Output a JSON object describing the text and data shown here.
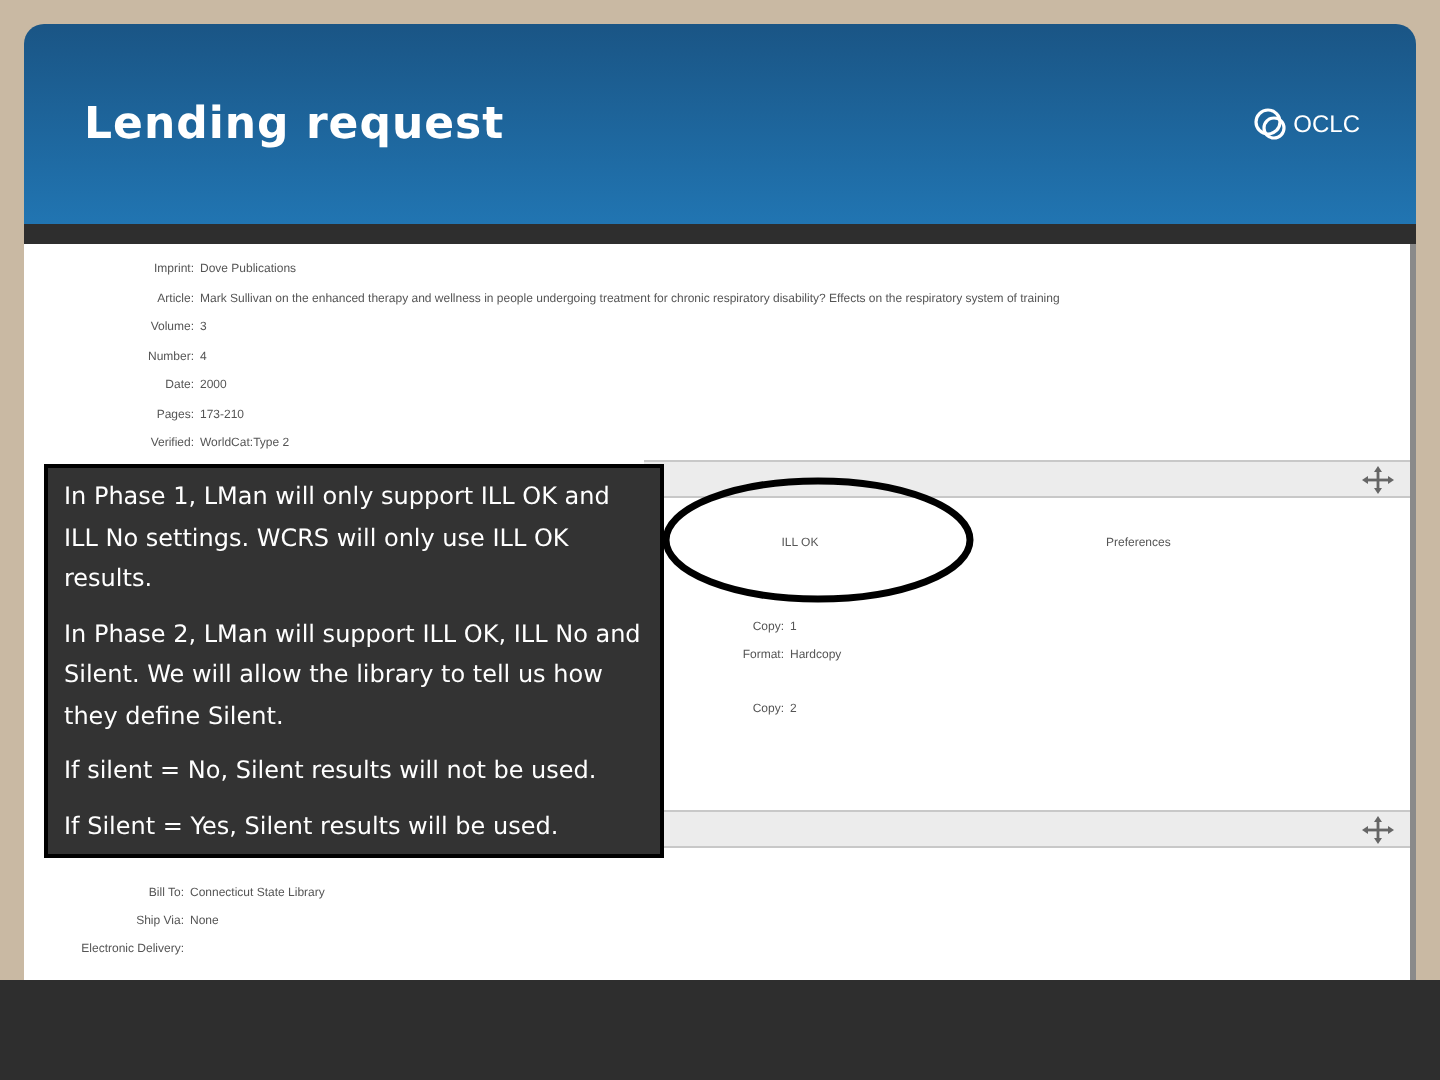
{
  "slide": {
    "title": "Lending request",
    "logo_text": "OCLC"
  },
  "screenshot": {
    "top_fields": [
      {
        "label": "Imprint:",
        "value": "Dove Publications"
      },
      {
        "label": "Article:",
        "value": "Mark Sullivan on the enhanced therapy and wellness in people undergoing treatment for chronic respiratory disability? Effects on the respiratory system of training"
      },
      {
        "label": "Volume:",
        "value": "3"
      },
      {
        "label": "Number:",
        "value": "4"
      },
      {
        "label": "Date:",
        "value": "2000"
      },
      {
        "label": "Pages:",
        "value": "173-210"
      },
      {
        "label": "Verified:",
        "value": "WorldCat:Type 2"
      }
    ],
    "middle": {
      "status": "ILL OK",
      "column_2": "Preferences",
      "copies": [
        {
          "label": "Copy:",
          "value": "1"
        },
        {
          "label": "Format:",
          "value": "Hardcopy"
        },
        {
          "label": "Copy:",
          "value": "2"
        }
      ]
    },
    "bottom_fields": [
      {
        "label": "Bill To:",
        "value": "Connecticut State Library"
      },
      {
        "label": "Ship Via:",
        "value": "None"
      },
      {
        "label": "Electronic Delivery:"
      }
    ]
  },
  "callout": [
    "In Phase 1, LMan will only support ILL OK and ILL No settings.  WCRS will only use ILL OK results.",
    "In Phase 2, LMan will support ILL OK, ILL No and Silent.  We will allow the library to tell us how they define Silent.",
    "If silent = No, Silent results will not be used.",
    "If Silent = Yes, Silent results will be used."
  ]
}
